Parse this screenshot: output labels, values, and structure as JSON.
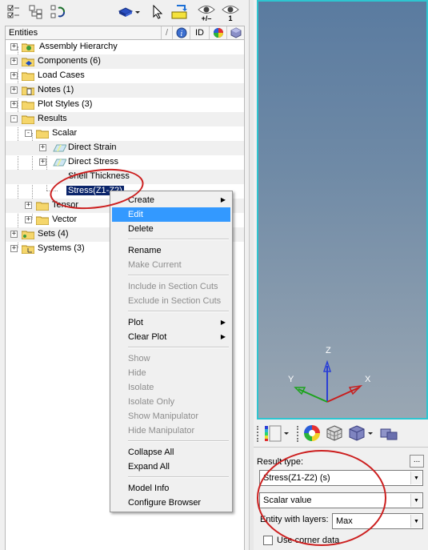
{
  "tree_header": {
    "entities_label": "Entities",
    "id_label": "ID"
  },
  "tree": {
    "items": [
      {
        "label": "Assembly Hierarchy",
        "expander": "+"
      },
      {
        "label": "Components (6)",
        "expander": "+"
      },
      {
        "label": "Load Cases",
        "expander": "+"
      },
      {
        "label": "Notes (1)",
        "expander": "+"
      },
      {
        "label": "Plot Styles (3)",
        "expander": "+"
      },
      {
        "label": "Results",
        "expander": "-"
      },
      {
        "label": "Scalar",
        "expander": "-"
      },
      {
        "label": "Direct Strain",
        "expander": "+"
      },
      {
        "label": "Direct Stress",
        "expander": "+"
      },
      {
        "label": "Shell Thickness",
        "expander": ""
      },
      {
        "label": "Stress(Z1-Z2)",
        "expander": ""
      },
      {
        "label": "Tensor",
        "expander": "+"
      },
      {
        "label": "Vector",
        "expander": "+"
      },
      {
        "label": "Sets  (4)",
        "expander": "+"
      },
      {
        "label": "Systems (3)",
        "expander": "+"
      }
    ]
  },
  "context_menu": {
    "items": [
      {
        "label": "Create",
        "disabled": false,
        "submenu": true
      },
      {
        "label": "Edit",
        "disabled": false,
        "hover": true
      },
      {
        "label": "Delete",
        "disabled": false
      },
      {
        "label": "Rename",
        "disabled": false
      },
      {
        "label": "Make Current",
        "disabled": true
      },
      {
        "label": "Include in Section Cuts",
        "disabled": true
      },
      {
        "label": "Exclude in Section Cuts",
        "disabled": true
      },
      {
        "label": "Plot",
        "disabled": false,
        "submenu": true
      },
      {
        "label": "Clear Plot",
        "disabled": false,
        "submenu": true
      },
      {
        "label": "Show",
        "disabled": true
      },
      {
        "label": "Hide",
        "disabled": true
      },
      {
        "label": "Isolate",
        "disabled": true
      },
      {
        "label": "Isolate Only",
        "disabled": true
      },
      {
        "label": "Show Manipulator",
        "disabled": true
      },
      {
        "label": "Hide Manipulator",
        "disabled": true
      },
      {
        "label": "Collapse All",
        "disabled": false
      },
      {
        "label": "Expand All",
        "disabled": false
      },
      {
        "label": "Model Info",
        "disabled": false
      },
      {
        "label": "Configure Browser",
        "disabled": false
      }
    ]
  },
  "toolbar": {
    "show_hide_label": "+/–",
    "show_one_label": "1"
  },
  "viewport": {
    "axis_x": "X",
    "axis_y": "Y",
    "axis_z": "Z",
    "border_color": "#2ec5d0"
  },
  "properties": {
    "result_type_label": "Result type:",
    "result_type_btn": "...",
    "result_type_value": "Stress(Z1-Z2) (s)",
    "scalar_value": "Scalar value",
    "entity_layers_label": "Entity with layers:",
    "entity_layers_value": "Max",
    "corner_data_label": "Use corner data"
  },
  "colors": {
    "selection": "#0a246a",
    "menu_hover": "#3399ff",
    "annotation": "#cc1f1f"
  }
}
